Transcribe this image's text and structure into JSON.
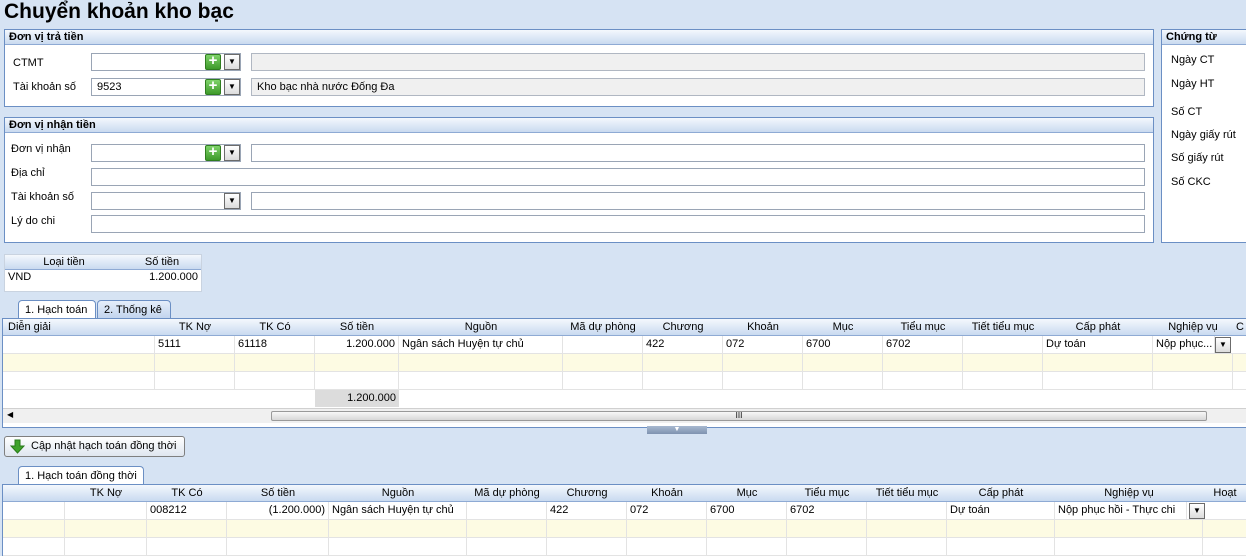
{
  "title": "Chuyển khoản kho bạc",
  "payer": {
    "header": "Đơn vị trả tiền",
    "fields": [
      {
        "label": "CTMT",
        "value": "",
        "desc": ""
      },
      {
        "label": "Tài khoản số",
        "value": "9523",
        "desc": "Kho bạc nhà nước Đống Đa"
      }
    ]
  },
  "payee": {
    "header": "Đơn vị nhận tiền",
    "unit_label": "Đơn vị nhận",
    "address_label": "Địa chỉ",
    "account_label": "Tài khoản số",
    "reason_label": "Lý do chi"
  },
  "voucher": {
    "header": "Chứng từ",
    "fields": [
      "Ngày CT",
      "Ngày HT",
      "Số CT",
      "Ngày giấy rút",
      "Số giấy rút",
      "Số CKC"
    ]
  },
  "money": {
    "headers": [
      "Loại tiền",
      "Số tiền"
    ],
    "row": [
      "VND",
      "1.200.000"
    ]
  },
  "tabs_top": [
    "1. Hạch toán",
    "2. Thống kê"
  ],
  "grid1": {
    "headers": [
      "Diễn giải",
      "TK Nợ",
      "TK Có",
      "Số tiền",
      "Nguồn",
      "Mã dự phòng",
      "Chương",
      "Khoản",
      "Mục",
      "Tiểu mục",
      "Tiết tiểu mục",
      "Cấp phát",
      "Nghiệp vụ",
      "C"
    ],
    "row": [
      "",
      "5111",
      "61118",
      "1.200.000",
      "Ngân sách Huyện tự chủ",
      "",
      "422",
      "072",
      "6700",
      "6702",
      "",
      "Dự toán",
      "Nộp phục...",
      ""
    ],
    "total": "1.200.000",
    "scroll_glyph": "III"
  },
  "update_button": "Cập nhật hạch toán đồng thời",
  "tabs_bottom": [
    "1. Hạch toán đồng thời"
  ],
  "grid2": {
    "headers": [
      "",
      "TK Nợ",
      "TK Có",
      "Số tiền",
      "Nguồn",
      "Mã dự phòng",
      "Chương",
      "Khoản",
      "Mục",
      "Tiểu mục",
      "Tiết tiểu mục",
      "Cấp phát",
      "Nghiệp vụ",
      "Hoạt"
    ],
    "row": [
      "",
      "",
      "008212",
      "(1.200.000)",
      "Ngân sách Huyện tự chủ",
      "",
      "422",
      "072",
      "6700",
      "6702",
      "",
      "Dự toán",
      "Nộp phục hồi - Thực chi",
      ""
    ]
  },
  "icons": {
    "plus": "plus-icon",
    "dropdown": "chevron-down-icon",
    "down_arrow": "green-down-arrow-icon"
  },
  "colors": {
    "background": "#d6e3f3",
    "border": "#6b8fc4",
    "alt_row": "#fdfbe3"
  }
}
